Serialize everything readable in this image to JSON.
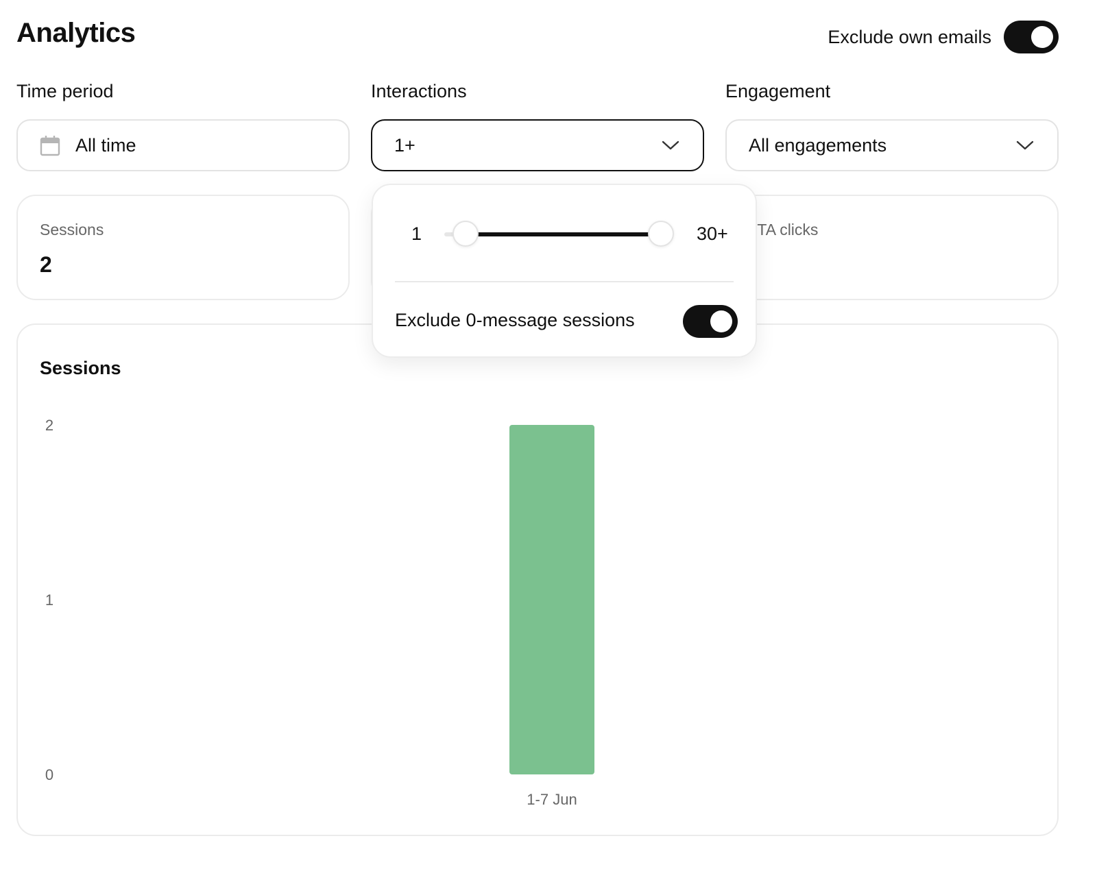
{
  "header": {
    "title": "Analytics",
    "exclude_own_emails_label": "Exclude own emails",
    "exclude_own_emails_on": true
  },
  "filters": {
    "time_period": {
      "label": "Time period",
      "value": "All time",
      "icon": "calendar-icon"
    },
    "interactions": {
      "label": "Interactions",
      "value": "1+",
      "icon": "chevron-down-icon"
    },
    "engagement": {
      "label": "Engagement",
      "value": "All engagements",
      "icon": "chevron-down-icon"
    }
  },
  "stats": {
    "sessions": {
      "label": "Sessions",
      "value": "2"
    },
    "cta_clicks": {
      "label": ":TA clicks"
    }
  },
  "interactions_popover": {
    "range_min_label": "1",
    "range_max_label": "30+",
    "selected_min": 1,
    "selected_max": 30,
    "scale_min": 0,
    "scale_max": 30,
    "exclude_zero_label": "Exclude 0-message sessions",
    "exclude_zero_on": true
  },
  "chart": {
    "title": "Sessions"
  },
  "chart_data": {
    "type": "bar",
    "title": "Sessions",
    "categories": [
      "1-7 Jun"
    ],
    "values": [
      2
    ],
    "ylim": [
      0,
      2
    ],
    "yticks": [
      "0",
      "1",
      "2"
    ],
    "xlabel": "",
    "ylabel": "",
    "grid": false,
    "bar_color": "#7bc18f"
  },
  "colors": {
    "accent": "#111111",
    "bar": "#7bc18f",
    "muted_text": "#666666"
  }
}
